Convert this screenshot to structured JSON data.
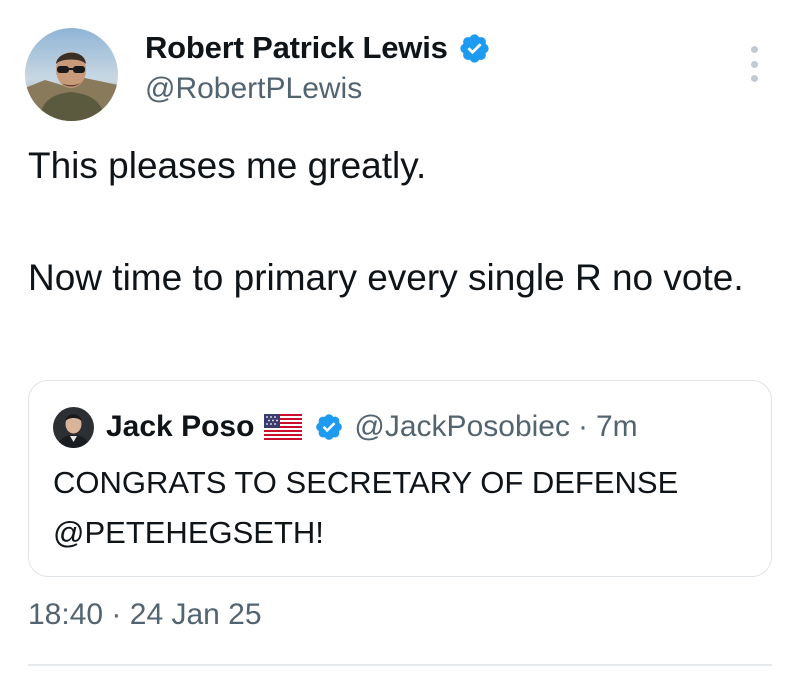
{
  "tweet": {
    "author": {
      "display_name": "Robert Patrick Lewis",
      "handle": "@RobertPLewis",
      "verified_icon": "verified-badge-icon",
      "avatar_icon": "avatar"
    },
    "text_lines": [
      "This pleases me greatly.",
      "Now time to primary every single R no vote."
    ],
    "timestamp": {
      "time": "18:40",
      "separator": "·",
      "date": "24 Jan 25"
    },
    "more_icon": "more-vertical-icon"
  },
  "quote": {
    "author": {
      "display_name": "Jack Poso",
      "flag_icon": "us-flag-icon",
      "verified_icon": "verified-badge-icon",
      "handle": "@JackPosobiec",
      "separator": "·",
      "time": "7m"
    },
    "text": "CONGRATS TO SECRETARY OF DEFENSE @PETEHEGSETH!"
  },
  "colors": {
    "text_primary": "#0f1419",
    "text_secondary": "#536471",
    "verified_blue": "#1d9bf0",
    "border": "#dfe4e8"
  }
}
